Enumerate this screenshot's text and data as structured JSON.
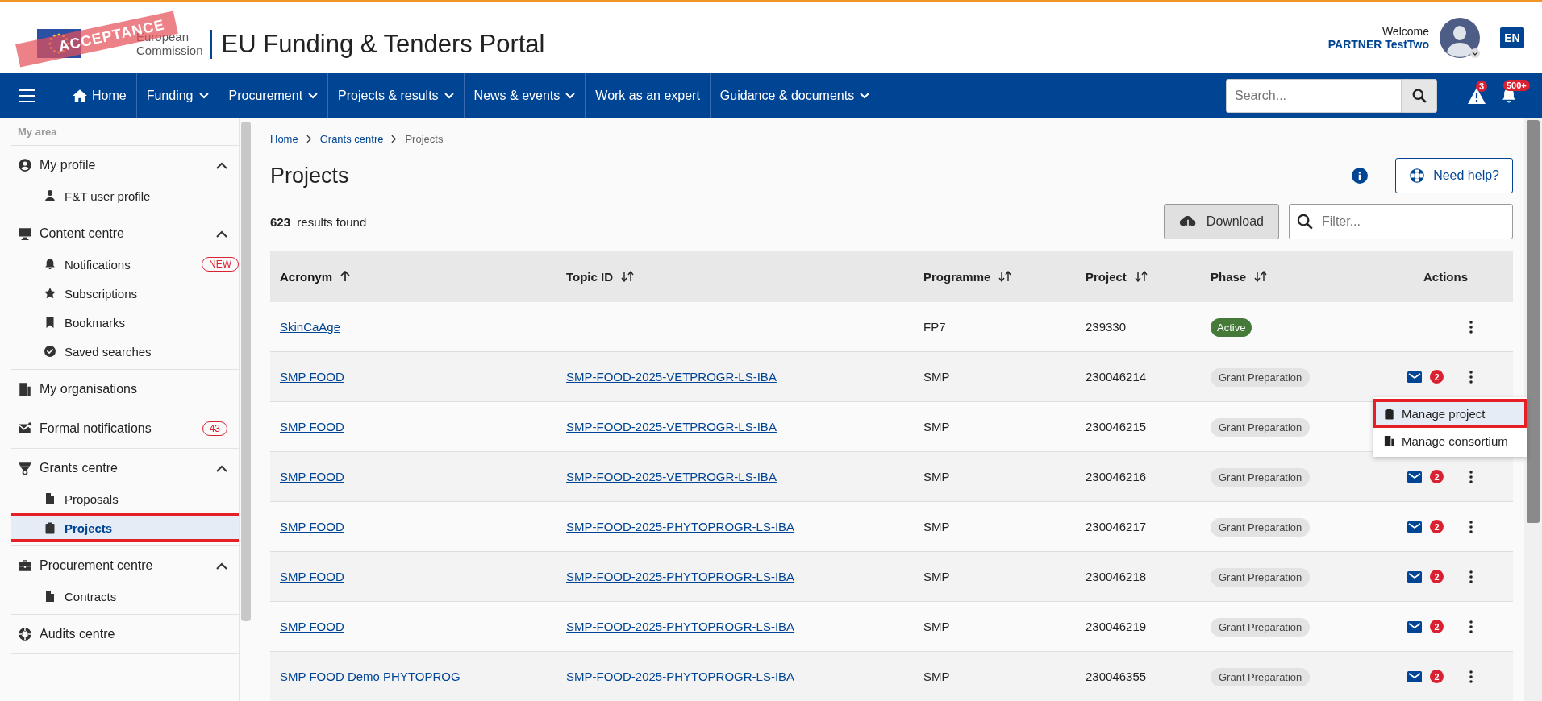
{
  "header": {
    "stamp": "ACCEPTANCE",
    "logo_lines": [
      "European",
      "Commission"
    ],
    "title": "EU Funding & Tenders Portal",
    "welcome": "Welcome",
    "user": "PARTNER TestTwo",
    "language": "EN"
  },
  "nav": {
    "items": [
      {
        "label": "Home",
        "kind": "home"
      },
      {
        "label": "Funding",
        "kind": "dropdown"
      },
      {
        "label": "Procurement",
        "kind": "dropdown"
      },
      {
        "label": "Projects & results",
        "kind": "dropdown"
      },
      {
        "label": "News & events",
        "kind": "dropdown"
      },
      {
        "label": "Work as an expert",
        "kind": "link"
      },
      {
        "label": "Guidance & documents",
        "kind": "dropdown"
      }
    ],
    "search": {
      "placeholder": "Search..."
    },
    "alerts": "3",
    "notifications": "500+"
  },
  "sidebar": {
    "heading": "My area",
    "sections": [
      {
        "label": "My profile",
        "expanded": true,
        "children": [
          {
            "label": "F&T user profile",
            "selected": false
          }
        ]
      },
      {
        "label": "Content centre",
        "expanded": true,
        "children": [
          {
            "label": "Notifications",
            "badge": "NEW",
            "selected": false
          },
          {
            "label": "Subscriptions",
            "selected": false
          },
          {
            "label": "Bookmarks",
            "selected": false
          },
          {
            "label": "Saved searches",
            "selected": false
          }
        ]
      },
      {
        "label": "My organisations"
      },
      {
        "label": "Formal notifications",
        "badge": "43"
      },
      {
        "label": "Grants centre",
        "expanded": true,
        "children": [
          {
            "label": "Proposals",
            "selected": false
          },
          {
            "label": "Projects",
            "selected": true
          }
        ]
      },
      {
        "label": "Procurement centre",
        "expanded": true,
        "children": [
          {
            "label": "Contracts",
            "selected": false
          }
        ]
      },
      {
        "label": "Audits centre"
      }
    ]
  },
  "breadcrumb": [
    {
      "label": "Home",
      "kind": "link"
    },
    {
      "label": "Grants centre",
      "kind": "link"
    },
    {
      "label": "Projects",
      "kind": "current"
    }
  ],
  "page_title": "Projects",
  "help_button": "Need help?",
  "results": {
    "count": "623",
    "text": "results found"
  },
  "download_button": "Download",
  "filter": {
    "placeholder": "Filter..."
  },
  "table": {
    "columns": [
      {
        "label": "Acronym",
        "sortable": true,
        "sorted": true
      },
      {
        "label": "Topic ID",
        "sortable": true,
        "sorted": false
      },
      {
        "label": "Programme",
        "sortable": true,
        "sorted": false
      },
      {
        "label": "Project",
        "sortable": true,
        "sorted": false
      },
      {
        "label": "Phase",
        "sortable": true,
        "sorted": false
      },
      {
        "label": "Actions",
        "sortable": false,
        "sorted": false
      }
    ],
    "rows": [
      {
        "acronym": "SkinCaAge",
        "programme": "FP7",
        "project": "239330",
        "phase": {
          "label": "Active",
          "kind": "active"
        }
      },
      {
        "acronym": "SMP FOOD",
        "topic_id": "SMP-FOOD-2025-VETPROGR-LS-IBA",
        "programme": "SMP",
        "project": "230046214",
        "phase": {
          "label": "Grant Preparation",
          "kind": "preparation"
        },
        "messages": "2"
      },
      {
        "acronym": "SMP FOOD",
        "topic_id": "SMP-FOOD-2025-VETPROGR-LS-IBA",
        "programme": "SMP",
        "project": "230046215",
        "phase": {
          "label": "Grant Preparation",
          "kind": "preparation"
        }
      },
      {
        "acronym": "SMP FOOD",
        "topic_id": "SMP-FOOD-2025-VETPROGR-LS-IBA",
        "programme": "SMP",
        "project": "230046216",
        "phase": {
          "label": "Grant Preparation",
          "kind": "preparation"
        },
        "messages": "2"
      },
      {
        "acronym": "SMP FOOD",
        "topic_id": "SMP-FOOD-2025-PHYTOPROGR-LS-IBA",
        "programme": "SMP",
        "project": "230046217",
        "phase": {
          "label": "Grant Preparation",
          "kind": "preparation"
        },
        "messages": "2"
      },
      {
        "acronym": "SMP FOOD",
        "topic_id": "SMP-FOOD-2025-PHYTOPROGR-LS-IBA",
        "programme": "SMP",
        "project": "230046218",
        "phase": {
          "label": "Grant Preparation",
          "kind": "preparation"
        },
        "messages": "2"
      },
      {
        "acronym": "SMP FOOD",
        "topic_id": "SMP-FOOD-2025-PHYTOPROGR-LS-IBA",
        "programme": "SMP",
        "project": "230046219",
        "phase": {
          "label": "Grant Preparation",
          "kind": "preparation"
        },
        "messages": "2"
      },
      {
        "acronym": "SMP FOOD Demo PHYTOPROG",
        "topic_id": "SMP-FOOD-2025-PHYTOPROGR-LS-IBA",
        "programme": "SMP",
        "project": "230046355",
        "phase": {
          "label": "Grant Preparation",
          "kind": "preparation"
        },
        "messages": "2"
      }
    ]
  },
  "row_menu": {
    "items": [
      {
        "label": "Manage project",
        "selected": true
      },
      {
        "label": "Manage consortium",
        "selected": false
      }
    ]
  }
}
